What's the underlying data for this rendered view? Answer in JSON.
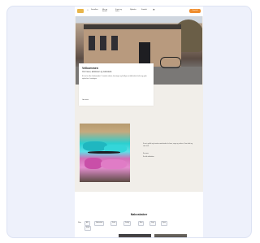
{
  "nav": {
    "items": [
      "Socialhus",
      "Min og familie",
      "Kunst og kultur",
      "Nyheder",
      "Kontakt"
    ],
    "cta_label": "Kontakt"
  },
  "hero": {
    "title": "Velkommen",
    "subtitle": "Om huset, aktiviteter og naboskab",
    "text": "Et hus for alle i lokalområdet. Vi samler naboer, foreninger og frivillige om fællesskab, kultur og gode oplevelser i hverdagen.",
    "more_link": "Læs mere"
  },
  "section2": {
    "text": "Kunst, graffiti og kreative værksteder for børn, unge og voksne. Kom forbi og vær med.",
    "link_1": "Se mere",
    "link_2": "Se alle aktiviteter"
  },
  "neighbours": {
    "title": "Naboskaber",
    "filter_label": "Filter",
    "chips": [
      "Alle",
      "Fællesskab",
      "Kultur",
      "Frivillig",
      "Børn",
      "Unge",
      "Sport",
      "Musik"
    ]
  },
  "colors": {
    "accent": "#ef8d2e",
    "page_beige": "#f1eee9",
    "frame_bg": "#eef1fb"
  }
}
